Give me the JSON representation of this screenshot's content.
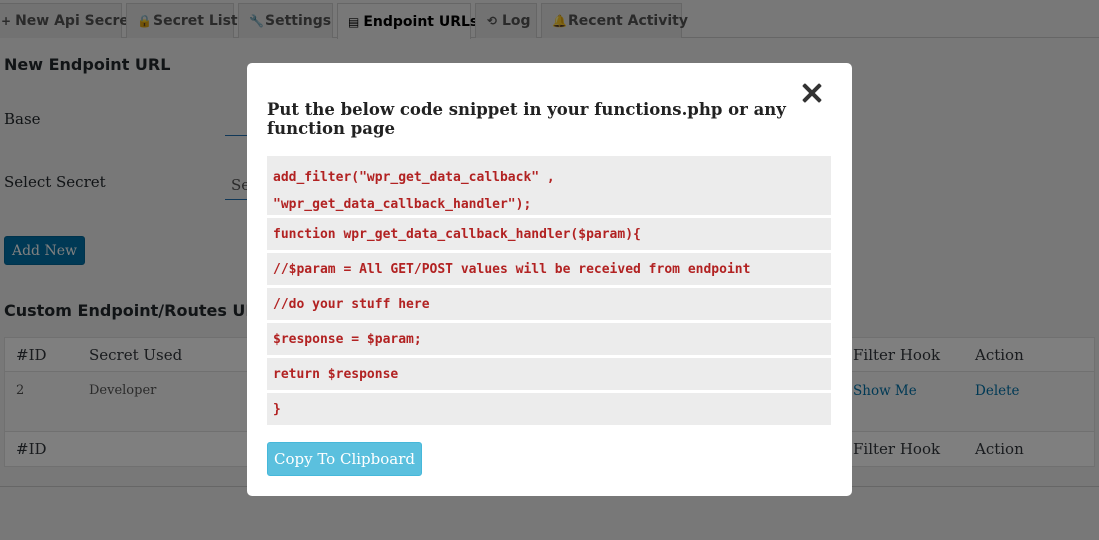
{
  "tabs": [
    {
      "label": "New Api Secret",
      "icon": "+"
    },
    {
      "label": "Secret List",
      "icon": "🔒"
    },
    {
      "label": "Settings",
      "icon": "🔧"
    },
    {
      "label": "Endpoint URLs",
      "icon": "▤"
    },
    {
      "label": "Log",
      "icon": "⟲"
    },
    {
      "label": "Recent Activity",
      "icon": "🔔"
    }
  ],
  "form": {
    "heading": "New Endpoint URL",
    "base_label": "Base",
    "select_label": "Select Secret",
    "select_value": "Se",
    "add_button": "Add New"
  },
  "routes": {
    "heading": "Custom Endpoint/Routes URLs",
    "columns": [
      "#ID",
      "Secret Used",
      "Filter Hook",
      "Action"
    ],
    "rows": [
      {
        "id": "2",
        "secret": "Developer",
        "filter_hook": "Show Me",
        "action": "Delete"
      }
    ]
  },
  "modal": {
    "title": "Put the below code snippet in your functions.php or any function page",
    "code_lines": [
      "add_filter(\"wpr_get_data_callback\" ,\n\"wpr_get_data_callback_handler\");",
      "function wpr_get_data_callback_handler($param){",
      "//$param = All GET/POST values will be received from endpoint",
      "//do your stuff here",
      "$response = $param;",
      "return $response",
      "}"
    ],
    "copy_button": "Copy To Clipboard"
  }
}
